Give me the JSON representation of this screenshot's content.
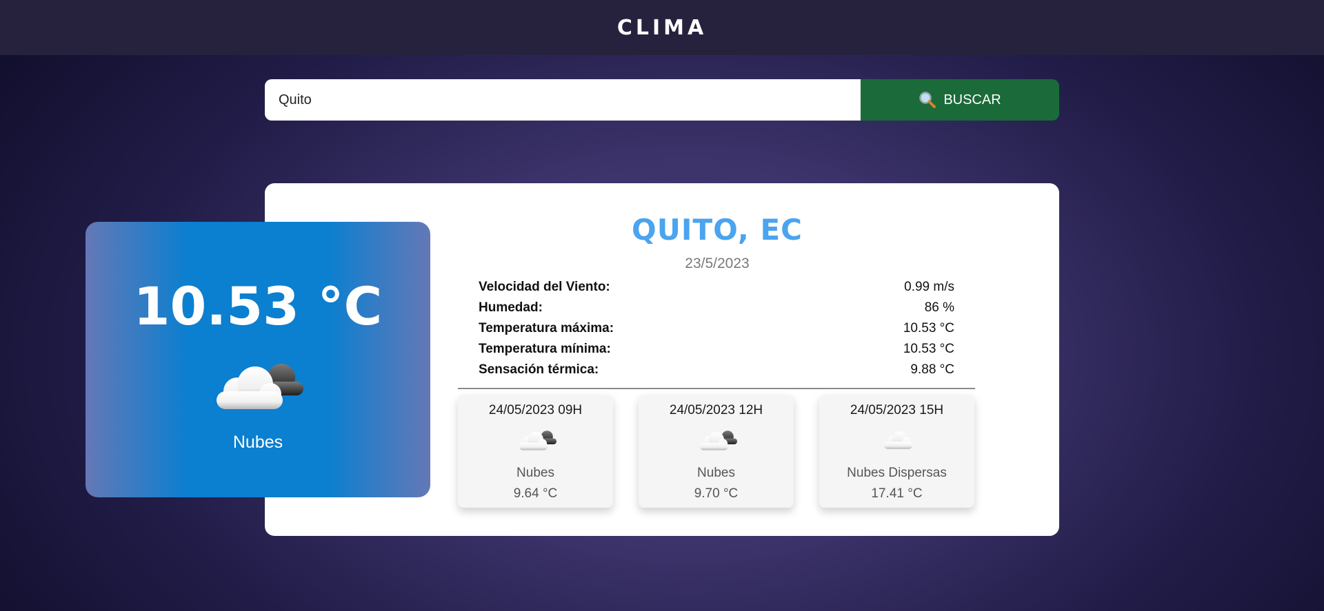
{
  "app": {
    "title": "CLIMA"
  },
  "search": {
    "value": "Quito",
    "button_label": "BUSCAR"
  },
  "current": {
    "temperature": "10.53 °C",
    "description": "Nubes",
    "icon": "broken-clouds-icon"
  },
  "location": {
    "city": "QUITO, EC",
    "date": "23/5/2023"
  },
  "details": [
    {
      "label": "Velocidad del Viento:",
      "value": "0.99 m/s"
    },
    {
      "label": "Humedad:",
      "value": "86 %"
    },
    {
      "label": "Temperatura máxima:",
      "value": "10.53 °C"
    },
    {
      "label": "Temperatura mínima:",
      "value": "10.53 °C"
    },
    {
      "label": "Sensación térmica:",
      "value": "9.88 °C"
    }
  ],
  "forecast": [
    {
      "datetime": "24/05/2023 09H",
      "description": "Nubes",
      "temp": "9.64 °C",
      "icon": "broken-clouds-icon"
    },
    {
      "datetime": "24/05/2023 12H",
      "description": "Nubes",
      "temp": "9.70 °C",
      "icon": "broken-clouds-icon"
    },
    {
      "datetime": "24/05/2023 15H",
      "description": "Nubes Dispersas",
      "temp": "17.41 °C",
      "icon": "scattered-clouds-icon"
    }
  ],
  "colors": {
    "header": "#26223e",
    "button": "#1b6b3a",
    "temp_card": "#0b7fd0",
    "city": "#4aa4ef"
  }
}
